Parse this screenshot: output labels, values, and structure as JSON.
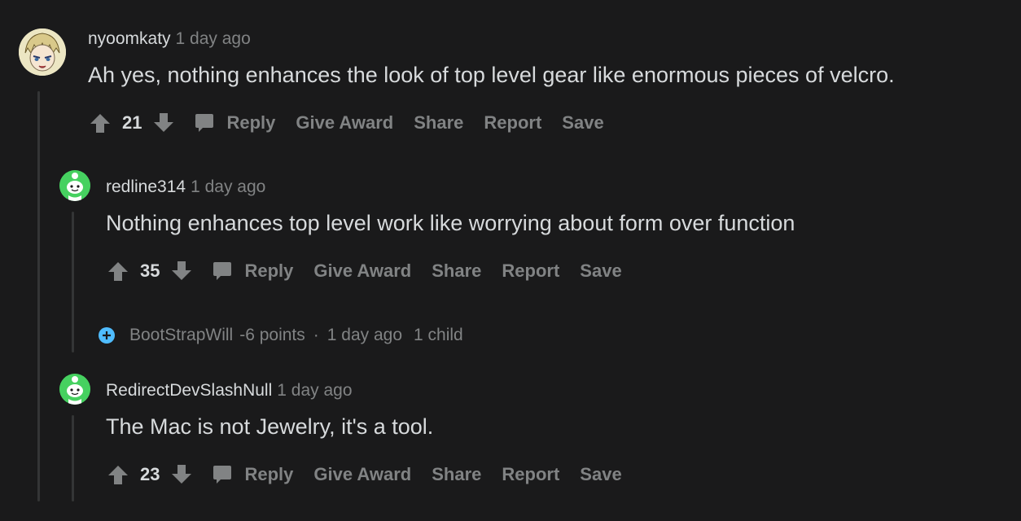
{
  "comments": [
    {
      "author": "nyoomkaty",
      "time": "1 day ago",
      "body": "Ah yes, nothing enhances the look of top level gear like enormous pieces of velcro.",
      "score": "21",
      "avatar": "anime-character-avatar"
    },
    {
      "author": "redline314",
      "time": "1 day ago",
      "body": "Nothing enhances top level work like worrying about form over function",
      "score": "35",
      "avatar": "green-snoo-avatar"
    },
    {
      "author": "RedirectDevSlashNull",
      "time": "1 day ago",
      "body": "The Mac is not Jewelry, it's a tool.",
      "score": "23",
      "avatar": "green-snoo-avatar"
    }
  ],
  "collapsed": {
    "author": "BootStrapWill",
    "points": "-6 points",
    "separator": "·",
    "time": "1 day ago",
    "children": "1 child"
  },
  "actions": {
    "reply": "Reply",
    "give_award": "Give Award",
    "share": "Share",
    "report": "Report",
    "save": "Save"
  },
  "colors": {
    "background": "#1a1a1b",
    "text": "#d7dadc",
    "muted": "#818384",
    "thread_line": "#343536",
    "expand_accent": "#4fbcff",
    "snoo_green": "#46d160"
  }
}
